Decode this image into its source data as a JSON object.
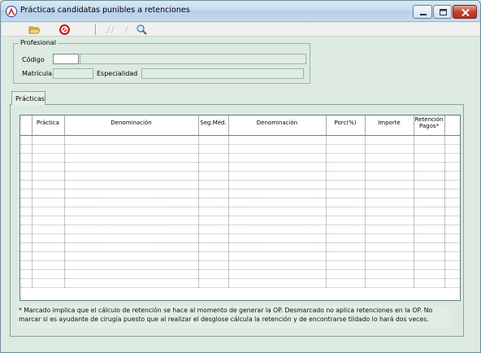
{
  "window": {
    "title": "Prácticas candidatas punibles a retenciones"
  },
  "toolbar": {
    "items": [
      "open-folder-icon",
      "cancel-icon",
      "magnifier-icon"
    ]
  },
  "profesional": {
    "group_label": "Profesional",
    "codigo_label": "Código",
    "codigo_value": "",
    "codigo_name": "",
    "matricula_label": "Matrícula",
    "matricula_value": "",
    "especialidad_label": "Especialidad",
    "especialidad_value": ""
  },
  "tabs": [
    {
      "label": "Prácticas"
    }
  ],
  "grid": {
    "columns": [
      "",
      "Práctica",
      "Denominación",
      "Seg.Méd.",
      "Denominación",
      "Porc(%)",
      "Importe",
      "Retención Pagos*",
      ""
    ],
    "row_count": 17
  },
  "footnote": "* Marcado implica que el cálculo de retención se hace al momento de generar la OP. Desmarcado no aplica retenciones en la OP. No marcar si es ayudante de cirugía  puesto que al realizar el desglose cálcula la retención y de encontrarse tildado lo hará dos veces."
}
